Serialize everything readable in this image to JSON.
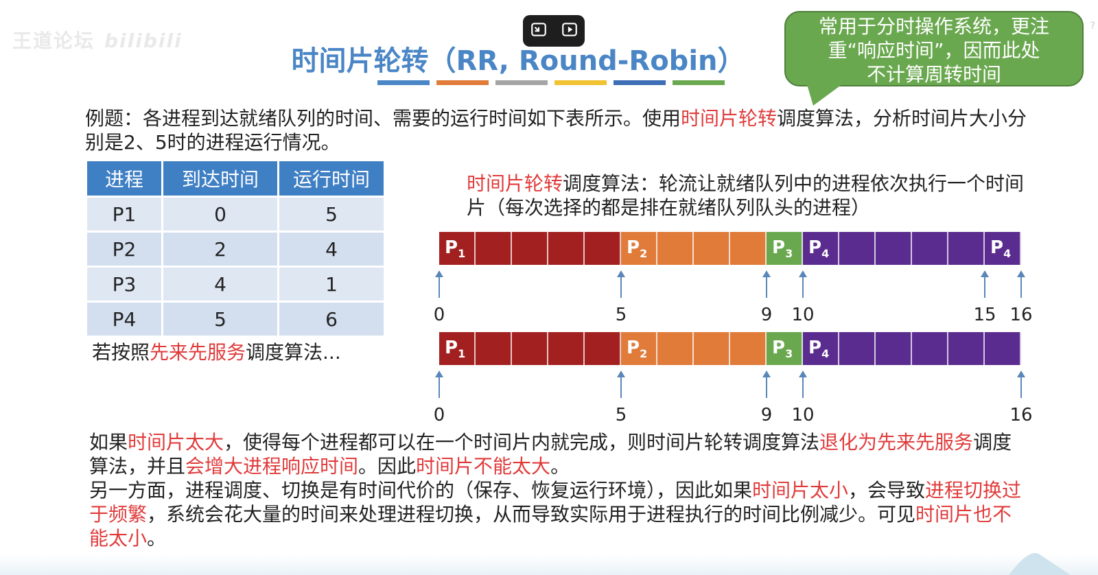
{
  "watermark": {
    "text": "王道论坛",
    "brand": "bilibili"
  },
  "title": "时间片轮转（RR, Round-Robin）",
  "callout": {
    "lines": [
      "常用于分时操作系统，更注",
      "重“响应时间”，因而此处",
      "不计算周转时间"
    ]
  },
  "question": {
    "part1": "例题：各进程到达就绪队列的时间、需要的运行时间如下表所示。使用",
    "highlight": "时间片轮转",
    "part2": "调度算法，分析时间片大小分别是2、5时的进程运行情况。"
  },
  "table": {
    "headers": [
      "进程",
      "到达时间",
      "运行时间"
    ],
    "rows": [
      [
        "P1",
        "0",
        "5"
      ],
      [
        "P2",
        "2",
        "4"
      ],
      [
        "P3",
        "4",
        "1"
      ],
      [
        "P4",
        "5",
        "6"
      ]
    ]
  },
  "fcfs_note": {
    "part1": "若按照",
    "highlight": "先来先服务",
    "part2": "调度算法..."
  },
  "rr_desc": {
    "highlight": "时间片轮转",
    "rest": "调度算法：轮流让就绪队列中的进程依次执行一个时间片（每次选择的都是排在就绪队列队头的进程）"
  },
  "gantt_rr": {
    "segments": [
      {
        "proc": "P",
        "sub": "1",
        "start": 0,
        "end": 5,
        "color": "#a32020"
      },
      {
        "proc": "P",
        "sub": "2",
        "start": 5,
        "end": 9,
        "color": "#e07b3a"
      },
      {
        "proc": "P",
        "sub": "3",
        "start": 9,
        "end": 10,
        "color": "#6aa84f"
      },
      {
        "proc": "P",
        "sub": "4",
        "start": 10,
        "end": 15,
        "color": "#5b2c8f"
      },
      {
        "proc": "P",
        "sub": "4",
        "start": 15,
        "end": 16,
        "color": "#5b2c8f"
      }
    ],
    "ticks": [
      "0",
      "5",
      "9",
      "10",
      "15",
      "16"
    ]
  },
  "gantt_fcfs": {
    "segments": [
      {
        "proc": "P",
        "sub": "1",
        "start": 0,
        "end": 5,
        "color": "#a32020"
      },
      {
        "proc": "P",
        "sub": "2",
        "start": 5,
        "end": 9,
        "color": "#e07b3a"
      },
      {
        "proc": "P",
        "sub": "3",
        "start": 9,
        "end": 10,
        "color": "#6aa84f"
      },
      {
        "proc": "P",
        "sub": "4",
        "start": 10,
        "end": 16,
        "color": "#5b2c8f"
      }
    ],
    "ticks": [
      "0",
      "5",
      "9",
      "10",
      "16"
    ]
  },
  "conclusion": {
    "p1": [
      {
        "t": "如果",
        "r": false
      },
      {
        "t": "时间片太大",
        "r": true
      },
      {
        "t": "，使得每个进程都可以在一个时间片内就完成，则时间片轮转调度算法",
        "r": false
      },
      {
        "t": "退化为先来先服务",
        "r": true
      },
      {
        "t": "调度算法，并且",
        "r": false
      },
      {
        "t": "会增大进程响应时间",
        "r": true
      },
      {
        "t": "。因此",
        "r": false
      },
      {
        "t": "时间片不能太大",
        "r": true
      },
      {
        "t": "。",
        "r": false
      }
    ],
    "p2": [
      {
        "t": "另一方面，进程调度、切换是有时间代价的（保存、恢复运行环境），因此如果",
        "r": false
      },
      {
        "t": "时间片太小",
        "r": true
      },
      {
        "t": "，会导致",
        "r": false
      },
      {
        "t": "进程切换过于频繁",
        "r": true
      },
      {
        "t": "，系统会花大量的时间来处理进程切换，从而导致实际用于进程执行的时间比例减少。可见",
        "r": false
      },
      {
        "t": "时间片也不能太小",
        "r": true
      },
      {
        "t": "。",
        "r": false
      }
    ]
  },
  "colors": {
    "title": "#4a86c5",
    "highlight": "#e03b3b",
    "callout": "#6aa84f",
    "table_header": "#3f7fc4"
  }
}
